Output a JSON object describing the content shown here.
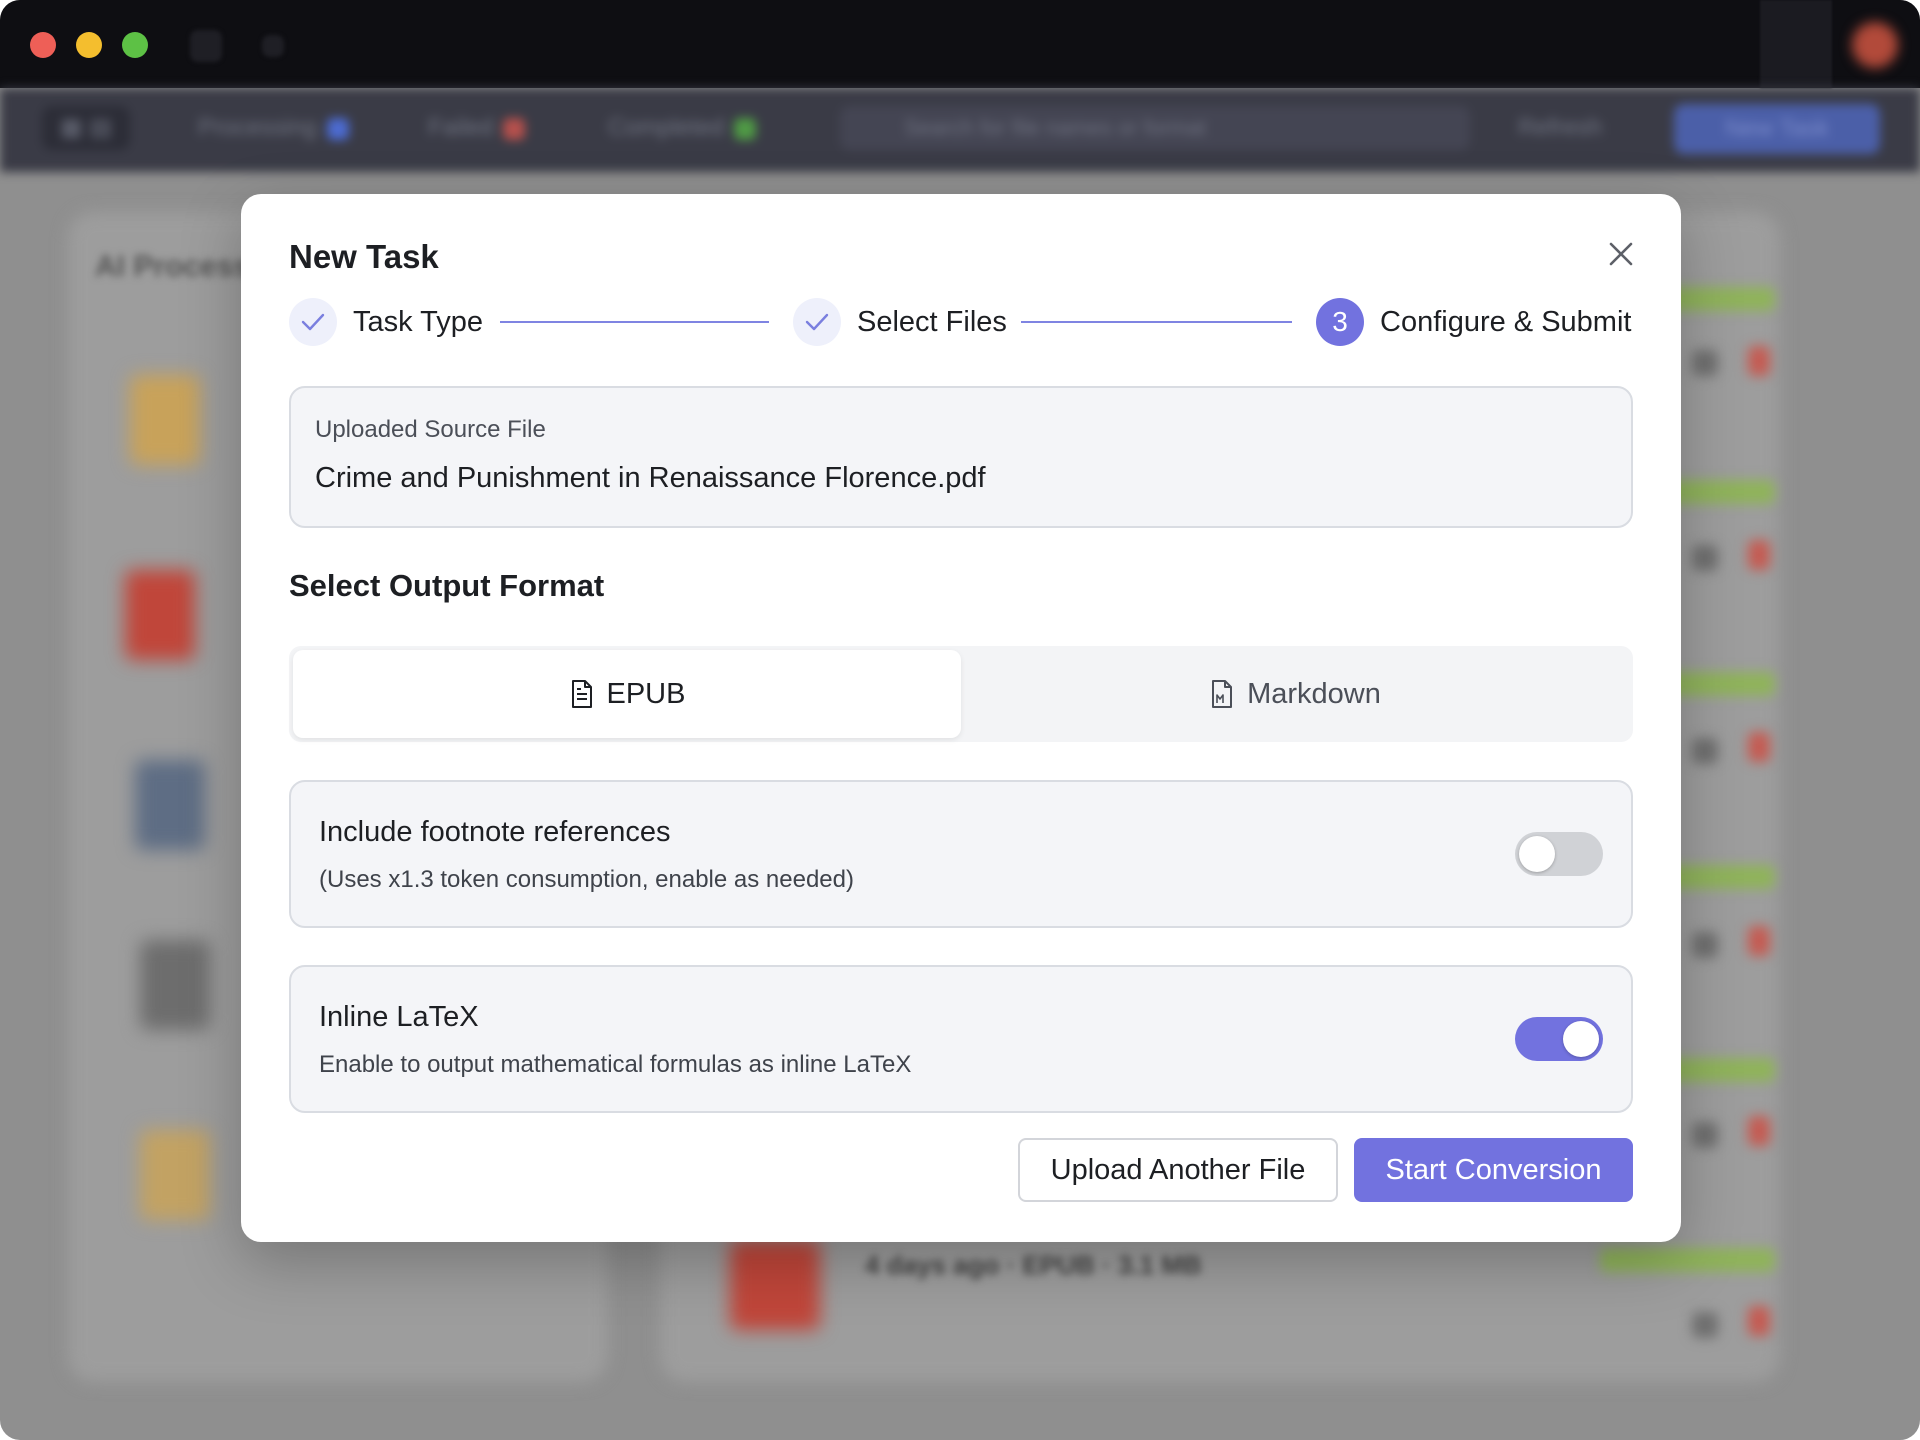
{
  "background": {
    "toolbar": {
      "view_toggle": "▦ ▤",
      "processing_label": "Processing",
      "failed_label": "Failed",
      "completed_label": "Completed",
      "search_placeholder": "Search for file names or format",
      "refresh_label": "Refresh",
      "new_task_label": "New Task"
    },
    "left_panel_title": "AI Process",
    "list_item_meta": "4 days ago · EPUB · 3.1 MB"
  },
  "modal": {
    "title": "New Task",
    "steps": [
      {
        "label": "Task Type",
        "status": "done"
      },
      {
        "label": "Select Files",
        "status": "done"
      },
      {
        "number": "3",
        "label": "Configure & Submit",
        "status": "active"
      }
    ],
    "source": {
      "caption": "Uploaded Source File",
      "filename": "Crime and Punishment in Renaissance Florence.pdf"
    },
    "output_format": {
      "title": "Select Output Format",
      "options": [
        {
          "label": "EPUB",
          "icon": "document-icon",
          "selected": true
        },
        {
          "label": "Markdown",
          "icon": "markdown-file-icon",
          "selected": false
        }
      ]
    },
    "options": [
      {
        "title": "Include footnote references",
        "description": "(Uses x1.3 token consumption, enable as needed)",
        "enabled": false
      },
      {
        "title": "Inline LaTeX",
        "description": "Enable to output mathematical formulas as inline LaTeX",
        "enabled": true
      }
    ],
    "buttons": {
      "secondary": "Upload Another File",
      "primary": "Start Conversion"
    }
  },
  "colors": {
    "accent": "#7272df",
    "step_line": "#7f84e2",
    "card_bg": "#f4f5f8"
  }
}
